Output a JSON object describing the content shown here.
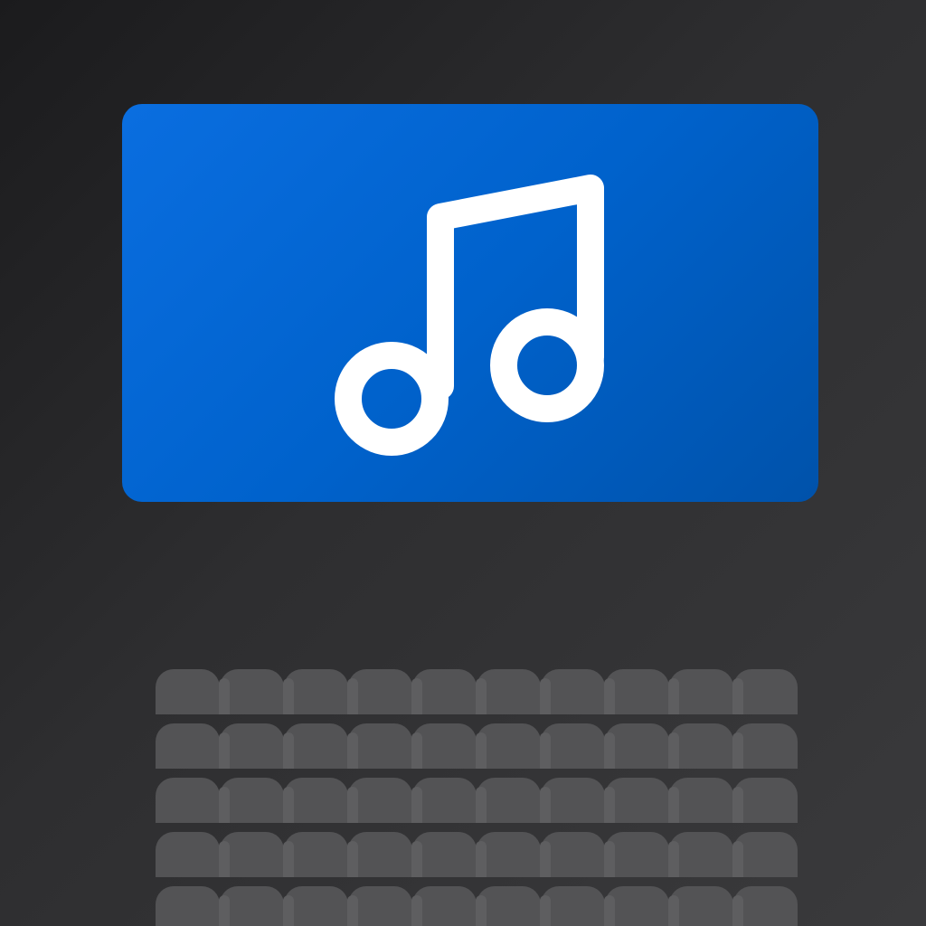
{
  "icon": {
    "name": "music-note-icon",
    "colors": {
      "background": "#2e2e30",
      "screen": "#0062cc",
      "note": "#ffffff",
      "seat": "#535355"
    }
  },
  "seating": {
    "rows": 5,
    "seats_per_row": 10
  }
}
